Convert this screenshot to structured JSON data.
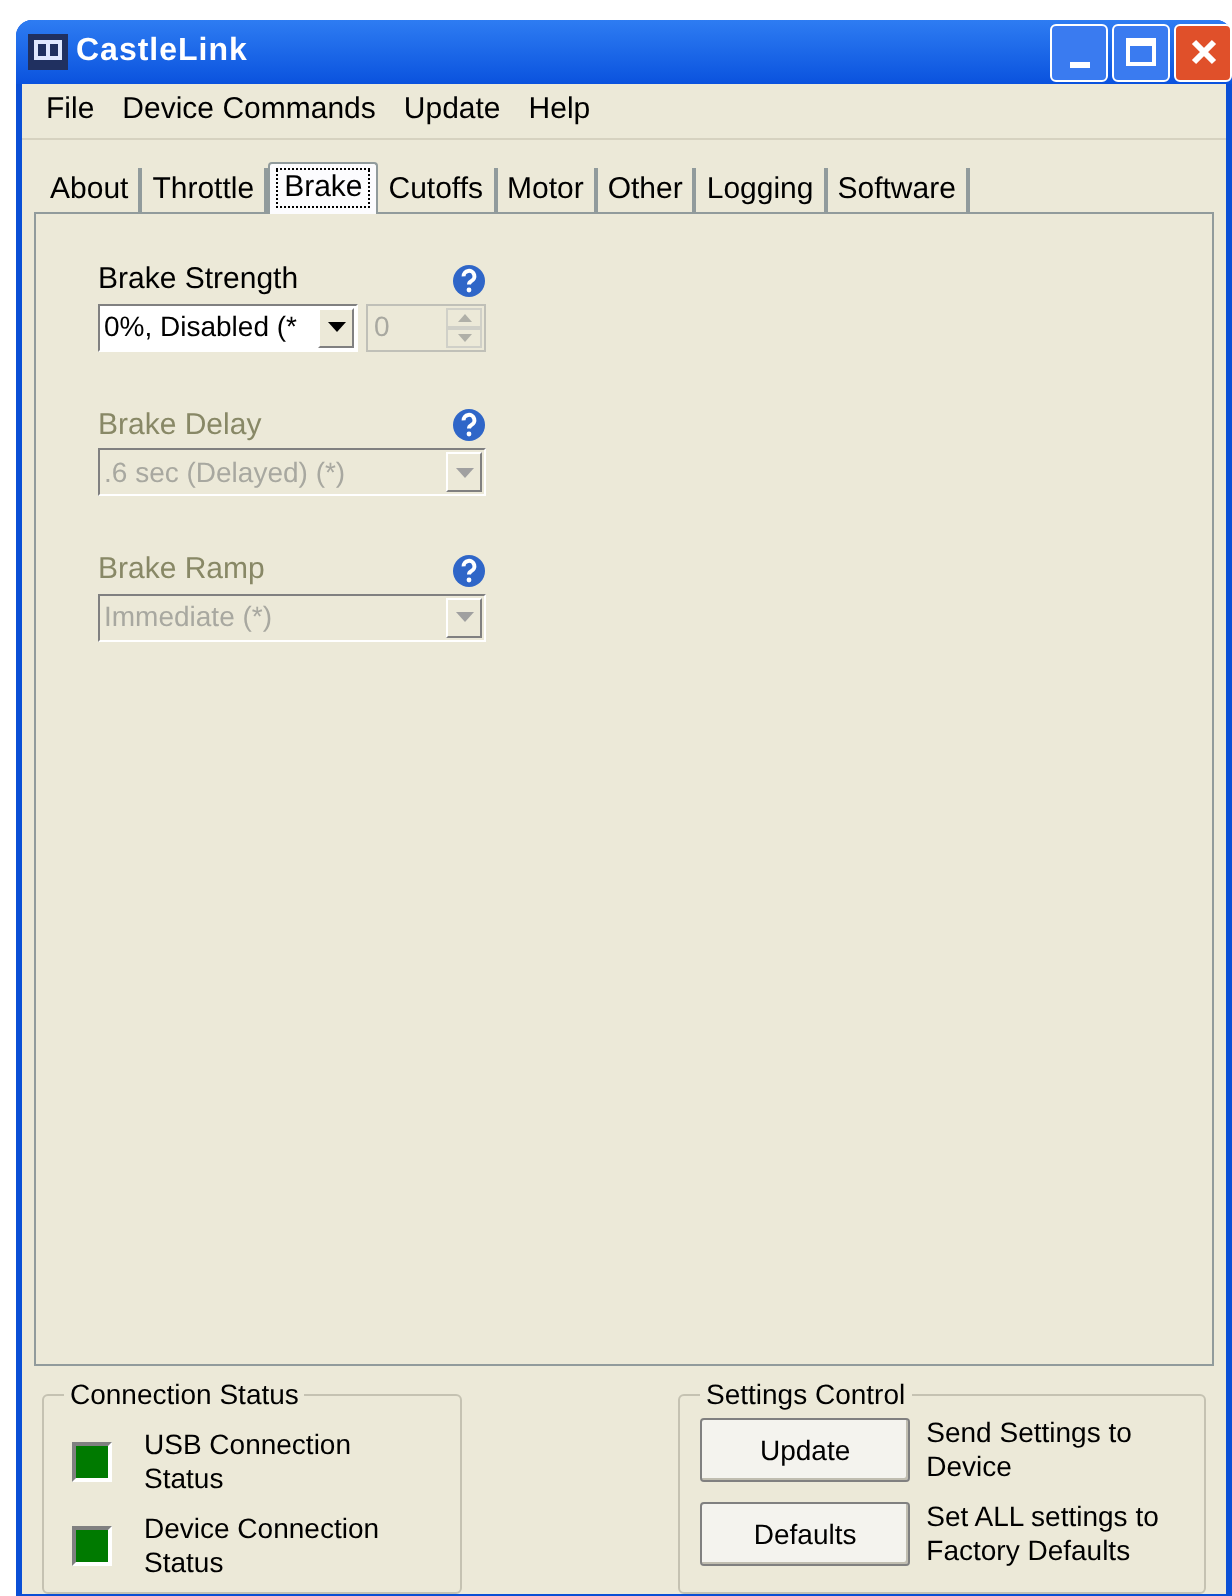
{
  "window": {
    "title": "CastleLink"
  },
  "menu": [
    "File",
    "Device Commands",
    "Update",
    "Help"
  ],
  "tabs": [
    {
      "label": "About",
      "selected": false
    },
    {
      "label": "Throttle",
      "selected": false
    },
    {
      "label": "Brake",
      "selected": true
    },
    {
      "label": "Cutoffs",
      "selected": false
    },
    {
      "label": "Motor",
      "selected": false
    },
    {
      "label": "Other",
      "selected": false
    },
    {
      "label": "Logging",
      "selected": false
    },
    {
      "label": "Software",
      "selected": false
    }
  ],
  "settings": [
    {
      "label": "Brake Strength",
      "value": "0%, Disabled (*",
      "disabled": false,
      "spinner": {
        "value": "0",
        "disabled": true
      }
    },
    {
      "label": "Brake Delay",
      "value": ".6 sec (Delayed) (*)",
      "disabled": true
    },
    {
      "label": "Brake Ramp",
      "value": "Immediate (*)",
      "disabled": true
    }
  ],
  "connection_status": {
    "title": "Connection Status",
    "items": [
      {
        "label": "USB Connection Status",
        "on": true
      },
      {
        "label": "Device Connection Status",
        "on": true
      }
    ]
  },
  "settings_control": {
    "title": "Settings Control",
    "items": [
      {
        "button": "Update",
        "description": "Send Settings to Device"
      },
      {
        "button": "Defaults",
        "description": "Set ALL settings to Factory Defaults"
      }
    ]
  }
}
